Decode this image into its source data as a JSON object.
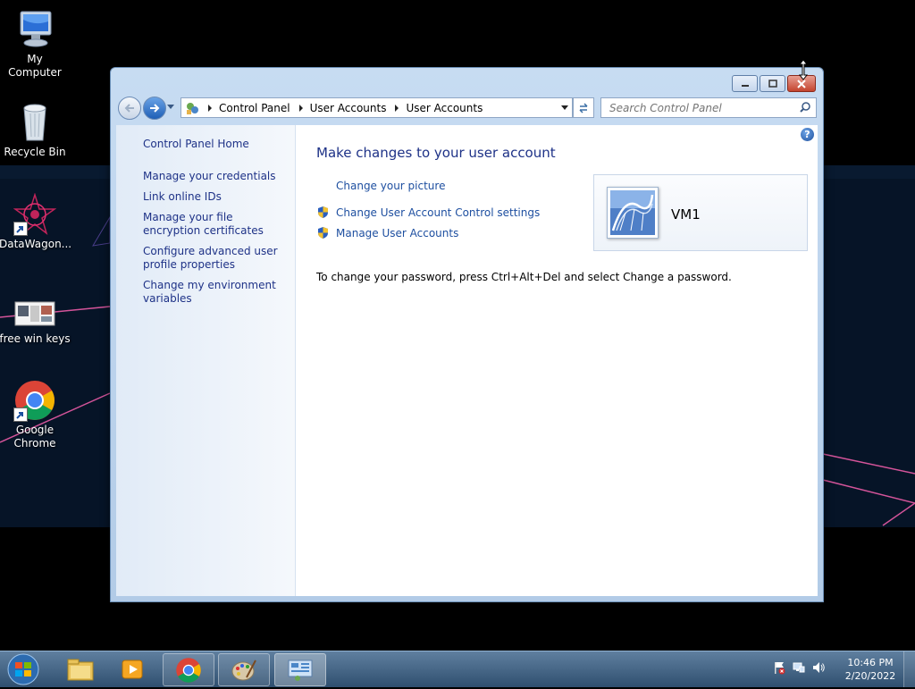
{
  "desktop": {
    "icons": [
      {
        "label": "My Computer"
      },
      {
        "label": "Recycle Bin"
      },
      {
        "label": "DataWagon..."
      },
      {
        "label": "free win keys"
      },
      {
        "label": "Google Chrome"
      }
    ]
  },
  "window": {
    "address": {
      "crumbs": [
        "Control Panel",
        "User Accounts",
        "User Accounts"
      ]
    },
    "search": {
      "placeholder": "Search Control Panel"
    },
    "left_pane": {
      "items": [
        "Control Panel Home",
        "Manage your credentials",
        "Link online IDs",
        "Manage your file encryption certificates",
        "Configure advanced user profile properties",
        "Change my environment variables"
      ]
    },
    "main": {
      "title": "Make changes to your user account",
      "tasks": [
        {
          "label": "Change your picture",
          "icon": "none"
        },
        {
          "label": "Change User Account Control settings",
          "icon": "shield-icon"
        },
        {
          "label": "Manage User Accounts",
          "icon": "shield-icon"
        }
      ],
      "user": {
        "name": "VM1"
      },
      "password_note": "To change your password, press Ctrl+Alt+Del and select Change a password."
    }
  },
  "taskbar": {
    "clock": {
      "time": "10:46 PM",
      "date": "2/20/2022"
    }
  }
}
